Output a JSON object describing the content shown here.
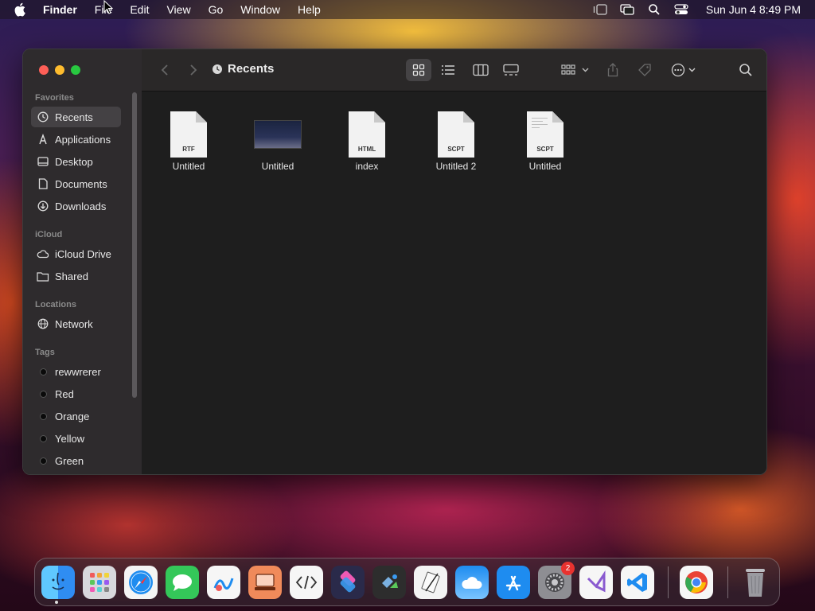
{
  "menubar": {
    "items": [
      "Finder",
      "File",
      "Edit",
      "View",
      "Go",
      "Window",
      "Help"
    ],
    "clock": "Sun Jun 4  8:49 PM"
  },
  "window": {
    "title": "Recents",
    "sidebar": {
      "favorites_label": "Favorites",
      "favorites": [
        "Recents",
        "Applications",
        "Desktop",
        "Documents",
        "Downloads"
      ],
      "icloud_label": "iCloud",
      "icloud": [
        "iCloud Drive",
        "Shared"
      ],
      "locations_label": "Locations",
      "locations": [
        "Network"
      ],
      "tags_label": "Tags",
      "tags": [
        "rewwrerer",
        "Red",
        "Orange",
        "Yellow",
        "Green"
      ]
    },
    "files": [
      {
        "name": "Untitled",
        "ext": "RTF"
      },
      {
        "name": "Untitled",
        "ext": ""
      },
      {
        "name": "index",
        "ext": "HTML"
      },
      {
        "name": "Untitled 2",
        "ext": "SCPT"
      },
      {
        "name": "Untitled",
        "ext": "SCPT"
      }
    ]
  },
  "dock": {
    "settings_badge": "2"
  },
  "colors": {
    "close": "#fe5f57",
    "minimize": "#febc2e",
    "zoom": "#28c840",
    "selected_sidebar": "#444144"
  }
}
